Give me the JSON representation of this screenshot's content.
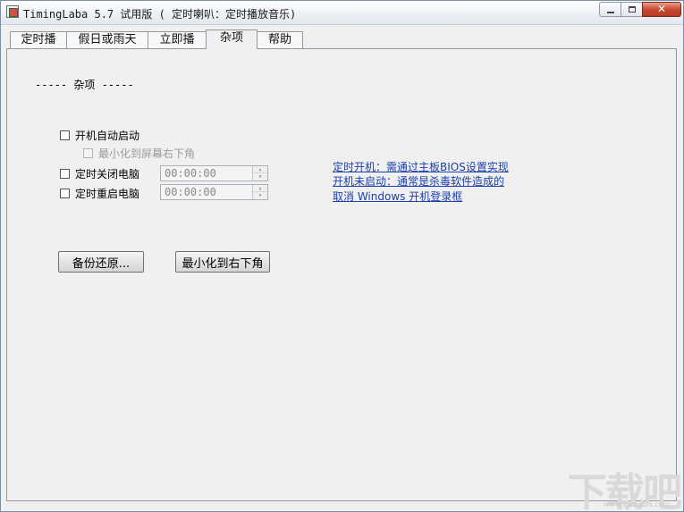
{
  "window": {
    "title": "TimingLaba 5.7 试用版 ( 定时喇叭：定时播放音乐)",
    "close_glyph": "✕"
  },
  "tabs": [
    {
      "label": "定时播",
      "active": false
    },
    {
      "label": "假日或雨天",
      "active": false
    },
    {
      "label": "立即播",
      "active": false
    },
    {
      "label": "杂项",
      "active": true
    },
    {
      "label": "帮助",
      "active": false
    }
  ],
  "misc": {
    "section_title": "----- 杂项 -----",
    "auto_start": {
      "label": "开机自动启动",
      "checked": false
    },
    "minimize_tray": {
      "label": "最小化到屏幕右下角",
      "checked": false,
      "enabled": false
    },
    "timed_shutdown": {
      "label": "定时关闭电脑",
      "checked": false,
      "time": "00:00:00"
    },
    "timed_restart": {
      "label": "定时重启电脑",
      "checked": false,
      "time": "00:00:00"
    },
    "links": [
      "定时开机：需通过主板BIOS设置实现",
      "开机未启动：通常是杀毒软件造成的",
      "取消 Windows 开机登录框"
    ],
    "backup_button": "备份还原...",
    "minimize_button": "最小化到右下角"
  },
  "watermark": {
    "text": "下载吧",
    "url": "www.xiazaiba.com"
  }
}
